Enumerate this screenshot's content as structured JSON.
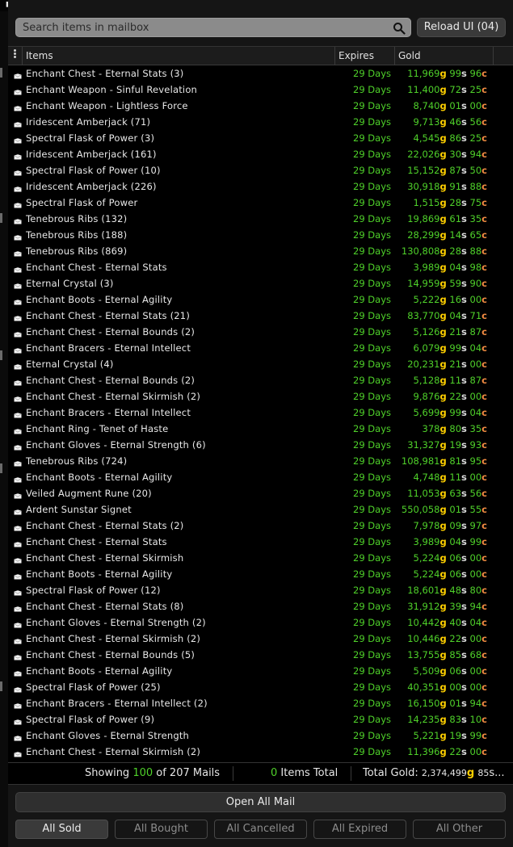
{
  "search": {
    "placeholder": "Search items in mailbox"
  },
  "reload_button": "Reload UI (04)",
  "table": {
    "columns": {
      "items": "Items",
      "expires": "Expires",
      "gold": "Gold"
    },
    "rows": [
      {
        "item": "Enchant Chest - Eternal Stats (3)",
        "expires": "29 Days",
        "gold": "11,969",
        "silver": "99",
        "copper": "96"
      },
      {
        "item": "Enchant Weapon - Sinful Revelation",
        "expires": "29 Days",
        "gold": "11,400",
        "silver": "72",
        "copper": "25"
      },
      {
        "item": "Enchant Weapon - Lightless Force",
        "expires": "29 Days",
        "gold": "8,740",
        "silver": "01",
        "copper": "00"
      },
      {
        "item": "Iridescent Amberjack (71)",
        "expires": "29 Days",
        "gold": "9,713",
        "silver": "46",
        "copper": "56"
      },
      {
        "item": "Spectral Flask of Power (3)",
        "expires": "29 Days",
        "gold": "4,545",
        "silver": "86",
        "copper": "25"
      },
      {
        "item": "Iridescent Amberjack (161)",
        "expires": "29 Days",
        "gold": "22,026",
        "silver": "30",
        "copper": "94"
      },
      {
        "item": "Spectral Flask of Power (10)",
        "expires": "29 Days",
        "gold": "15,152",
        "silver": "87",
        "copper": "50"
      },
      {
        "item": "Iridescent Amberjack (226)",
        "expires": "29 Days",
        "gold": "30,918",
        "silver": "91",
        "copper": "88"
      },
      {
        "item": "Spectral Flask of Power",
        "expires": "29 Days",
        "gold": "1,515",
        "silver": "28",
        "copper": "75"
      },
      {
        "item": "Tenebrous Ribs (132)",
        "expires": "29 Days",
        "gold": "19,869",
        "silver": "61",
        "copper": "35"
      },
      {
        "item": "Tenebrous Ribs (188)",
        "expires": "29 Days",
        "gold": "28,299",
        "silver": "14",
        "copper": "65"
      },
      {
        "item": "Tenebrous Ribs (869)",
        "expires": "29 Days",
        "gold": "130,808",
        "silver": "28",
        "copper": "88"
      },
      {
        "item": "Enchant Chest - Eternal Stats",
        "expires": "29 Days",
        "gold": "3,989",
        "silver": "04",
        "copper": "98"
      },
      {
        "item": "Eternal Crystal (3)",
        "expires": "29 Days",
        "gold": "14,959",
        "silver": "59",
        "copper": "90"
      },
      {
        "item": "Enchant Boots - Eternal Agility",
        "expires": "29 Days",
        "gold": "5,222",
        "silver": "16",
        "copper": "00"
      },
      {
        "item": "Enchant Chest - Eternal Stats (21)",
        "expires": "29 Days",
        "gold": "83,770",
        "silver": "04",
        "copper": "71"
      },
      {
        "item": "Enchant Chest - Eternal Bounds (2)",
        "expires": "29 Days",
        "gold": "5,126",
        "silver": "21",
        "copper": "87"
      },
      {
        "item": "Enchant Bracers - Eternal Intellect",
        "expires": "29 Days",
        "gold": "6,079",
        "silver": "99",
        "copper": "04"
      },
      {
        "item": "Eternal Crystal (4)",
        "expires": "29 Days",
        "gold": "20,231",
        "silver": "21",
        "copper": "00"
      },
      {
        "item": "Enchant Chest - Eternal Bounds (2)",
        "expires": "29 Days",
        "gold": "5,128",
        "silver": "11",
        "copper": "87"
      },
      {
        "item": "Enchant Chest - Eternal Skirmish (2)",
        "expires": "29 Days",
        "gold": "9,876",
        "silver": "22",
        "copper": "00"
      },
      {
        "item": "Enchant Bracers - Eternal Intellect",
        "expires": "29 Days",
        "gold": "5,699",
        "silver": "99",
        "copper": "04"
      },
      {
        "item": "Enchant Ring - Tenet of Haste",
        "expires": "29 Days",
        "gold": "378",
        "silver": "80",
        "copper": "35"
      },
      {
        "item": "Enchant Gloves - Eternal Strength (6)",
        "expires": "29 Days",
        "gold": "31,327",
        "silver": "19",
        "copper": "93"
      },
      {
        "item": "Tenebrous Ribs (724)",
        "expires": "29 Days",
        "gold": "108,981",
        "silver": "81",
        "copper": "95"
      },
      {
        "item": "Enchant Boots - Eternal Agility",
        "expires": "29 Days",
        "gold": "4,748",
        "silver": "11",
        "copper": "00"
      },
      {
        "item": "Veiled Augment Rune (20)",
        "expires": "29 Days",
        "gold": "11,053",
        "silver": "63",
        "copper": "56"
      },
      {
        "item": "Ardent Sunstar Signet",
        "expires": "29 Days",
        "gold": "550,058",
        "silver": "01",
        "copper": "55"
      },
      {
        "item": "Enchant Chest - Eternal Stats (2)",
        "expires": "29 Days",
        "gold": "7,978",
        "silver": "09",
        "copper": "97"
      },
      {
        "item": "Enchant Chest - Eternal Stats",
        "expires": "29 Days",
        "gold": "3,989",
        "silver": "04",
        "copper": "99"
      },
      {
        "item": "Enchant Chest - Eternal Skirmish",
        "expires": "29 Days",
        "gold": "5,224",
        "silver": "06",
        "copper": "00"
      },
      {
        "item": "Enchant Boots - Eternal Agility",
        "expires": "29 Days",
        "gold": "5,224",
        "silver": "06",
        "copper": "00"
      },
      {
        "item": "Spectral Flask of Power (12)",
        "expires": "29 Days",
        "gold": "18,601",
        "silver": "48",
        "copper": "80"
      },
      {
        "item": "Enchant Chest - Eternal Stats (8)",
        "expires": "29 Days",
        "gold": "31,912",
        "silver": "39",
        "copper": "94"
      },
      {
        "item": "Enchant Gloves - Eternal Strength (2)",
        "expires": "29 Days",
        "gold": "10,442",
        "silver": "40",
        "copper": "04"
      },
      {
        "item": "Enchant Chest - Eternal Skirmish (2)",
        "expires": "29 Days",
        "gold": "10,446",
        "silver": "22",
        "copper": "00"
      },
      {
        "item": "Enchant Chest - Eternal Bounds (5)",
        "expires": "29 Days",
        "gold": "13,755",
        "silver": "85",
        "copper": "68"
      },
      {
        "item": "Enchant Boots - Eternal Agility",
        "expires": "29 Days",
        "gold": "5,509",
        "silver": "06",
        "copper": "00"
      },
      {
        "item": "Spectral Flask of Power (25)",
        "expires": "29 Days",
        "gold": "40,351",
        "silver": "00",
        "copper": "00"
      },
      {
        "item": "Enchant Bracers - Eternal Intellect (2)",
        "expires": "29 Days",
        "gold": "16,150",
        "silver": "01",
        "copper": "94"
      },
      {
        "item": "Spectral Flask of Power (9)",
        "expires": "29 Days",
        "gold": "14,235",
        "silver": "83",
        "copper": "10"
      },
      {
        "item": "Enchant Gloves - Eternal Strength",
        "expires": "29 Days",
        "gold": "5,221",
        "silver": "19",
        "copper": "99"
      },
      {
        "item": "Enchant Chest - Eternal Skirmish (2)",
        "expires": "29 Days",
        "gold": "11,396",
        "silver": "22",
        "copper": "00"
      }
    ]
  },
  "currency": {
    "gold": "g",
    "silver": "s",
    "copper": "c"
  },
  "summary": {
    "showing_prefix": "Showing ",
    "showing_count": "100",
    "showing_suffix": " of 207 Mails",
    "items_count": "0",
    "items_label": " Items Total",
    "total_label": "Total Gold: ",
    "total_gold": "2,374,499",
    "total_silver": "85",
    "total_trail": "s..."
  },
  "open_all_button": "Open All Mail",
  "filters": [
    "All Sold",
    "All Bought",
    "All Cancelled",
    "All Expired",
    "All Other"
  ],
  "active_filter": "All Sold",
  "colors": {
    "expires_green": "#4fd12a",
    "gold_yellow": "#ffd000",
    "silver_grey": "#d8d8d8",
    "copper_orange": "#ef8a42"
  }
}
